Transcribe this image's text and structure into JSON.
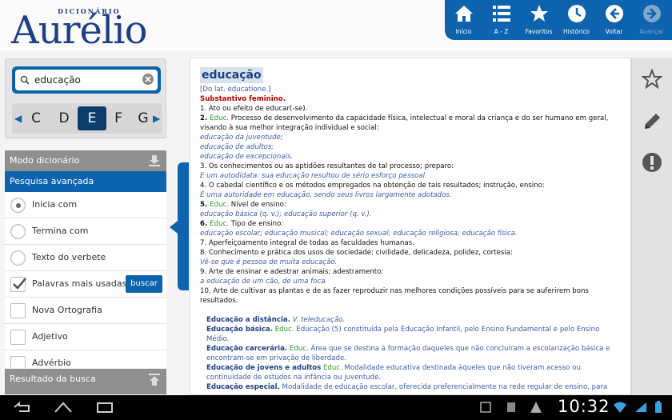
{
  "app": {
    "logo_small": "DICIONÁRIO",
    "logo_big": "Aurélio"
  },
  "nav": [
    {
      "label": "Início",
      "icon": "home-icon"
    },
    {
      "label": "A - Z",
      "icon": "list-icon"
    },
    {
      "label": "Favoritos",
      "icon": "star-icon"
    },
    {
      "label": "Histórico",
      "icon": "clock-icon"
    },
    {
      "label": "Voltar",
      "icon": "back-arrow-icon"
    },
    {
      "label": "Avançar",
      "icon": "forward-arrow-icon",
      "disabled": true
    }
  ],
  "search": {
    "value": "educação"
  },
  "letters": [
    "C",
    "D",
    "E",
    "F",
    "G"
  ],
  "selected_letter": "E",
  "panels": {
    "modo": "Modo dicionário",
    "pesquisa": "Pesquisa avançada",
    "resultado": "Resultado da busca",
    "buscar": "buscar"
  },
  "options": [
    {
      "label": "Inicia com",
      "type": "radio",
      "checked": true
    },
    {
      "label": "Termina com",
      "type": "radio",
      "checked": false
    },
    {
      "label": "Texto do verbete",
      "type": "radio",
      "checked": false
    },
    {
      "label": "Palavras mais usadas",
      "type": "checkbox",
      "checked": true
    },
    {
      "label": "Nova Ortografia",
      "type": "checkbox",
      "checked": false
    },
    {
      "label": "Adjetivo",
      "type": "checkbox",
      "checked": false
    },
    {
      "label": "Advérbio",
      "type": "checkbox",
      "checked": false
    }
  ],
  "entry": {
    "headword": "educação",
    "etymology": "[Do lat. educatione.]",
    "class": "Substantivo feminino.",
    "senses": {
      "s1": "1. Ato ou efeito de educar(-se).",
      "s2a": "2. ",
      "s2b": "Educ.",
      "s2c": " Processo de desenvolvimento da capacidade física, intelectual e moral da criança e do ser humano em geral, visando à sua melhor integração individual e social:",
      "s2ex1": "educação da juventude;",
      "s2ex2": "educação de adultos;",
      "s2ex3": "educação de excepcionais.",
      "s3": "3. Os conhecimentos ou as aptidões resultantes de tal processo; preparo:",
      "s3ex": "E um autodidata: sua educação resultou de sério esforço pessoal.",
      "s4": "4. O cabedal científico e os métodos empregados na obtenção de tais resultados; instrução, ensino:",
      "s4ex": "É uma autoridade em educação, sendo seus livros largamente adotados.",
      "s5a": "5. ",
      "s5b": "Educ.",
      "s5c": " Nível de ensino:",
      "s5ex": "educação básica (q. v.); educação superior (q. v.).",
      "s6a": "6. ",
      "s6b": "Educ.",
      "s6c": " Tipo de ensino:",
      "s6ex": "educação escolar; educação musical; educação sexual; educação religiosa; educação física.",
      "s7": "7. Aperfeiçoamento integral de todas as faculdades humanas.",
      "s8": "8. Conhecimento e prática dos usos de sociedade; civilidade, delicadeza, polidez, cortesia:",
      "s8ex": "Vê-se que é pessoa de muita educação.",
      "s9": "9. Arte de ensinar e adestrar animais; adestramento:",
      "s9ex": "a educação de um cão, de uma foca.",
      "s10": "10. Arte de cultivar as plantas e de as fazer reproduzir nas melhores condições possíveis para se auferirem bons resultados."
    },
    "subentries": {
      "e1t": "Educação a distância.",
      "e1d": " V. teleducação.",
      "e2t": "Educação básica.",
      "e2e": " Educ.",
      "e2d": " Educação (5) constituída pela Educação Infantil, pelo Ensino Fundamental e pelo Ensino Médio.",
      "e3t": "Educação carcerária.",
      "e3e": " Educ.",
      "e3d": " Área que se destina à formação daqueles que não concluíram a escolarização básica e encontram-se em privação de liberdade.",
      "e4t": "Educação de jovens e adultos",
      "e4e": " Educ.",
      "e4d": " Modalidade educativa destinada àqueles que não tiveram acesso ou continuidade de estudos na infância ou juventude.",
      "e5t": "Educação especial.",
      "e5d": " Modalidade de educação escolar, oferecida preferencialmente na rede regular de ensino, para"
    }
  },
  "side_actions": [
    "star-icon",
    "pencil-icon",
    "alert-icon"
  ],
  "status": {
    "time": "10:32"
  },
  "colors": {
    "accent": "#0d63ad",
    "headword": "#1d3f86",
    "class": "#c00000",
    "educ": "#2a9a2a"
  }
}
